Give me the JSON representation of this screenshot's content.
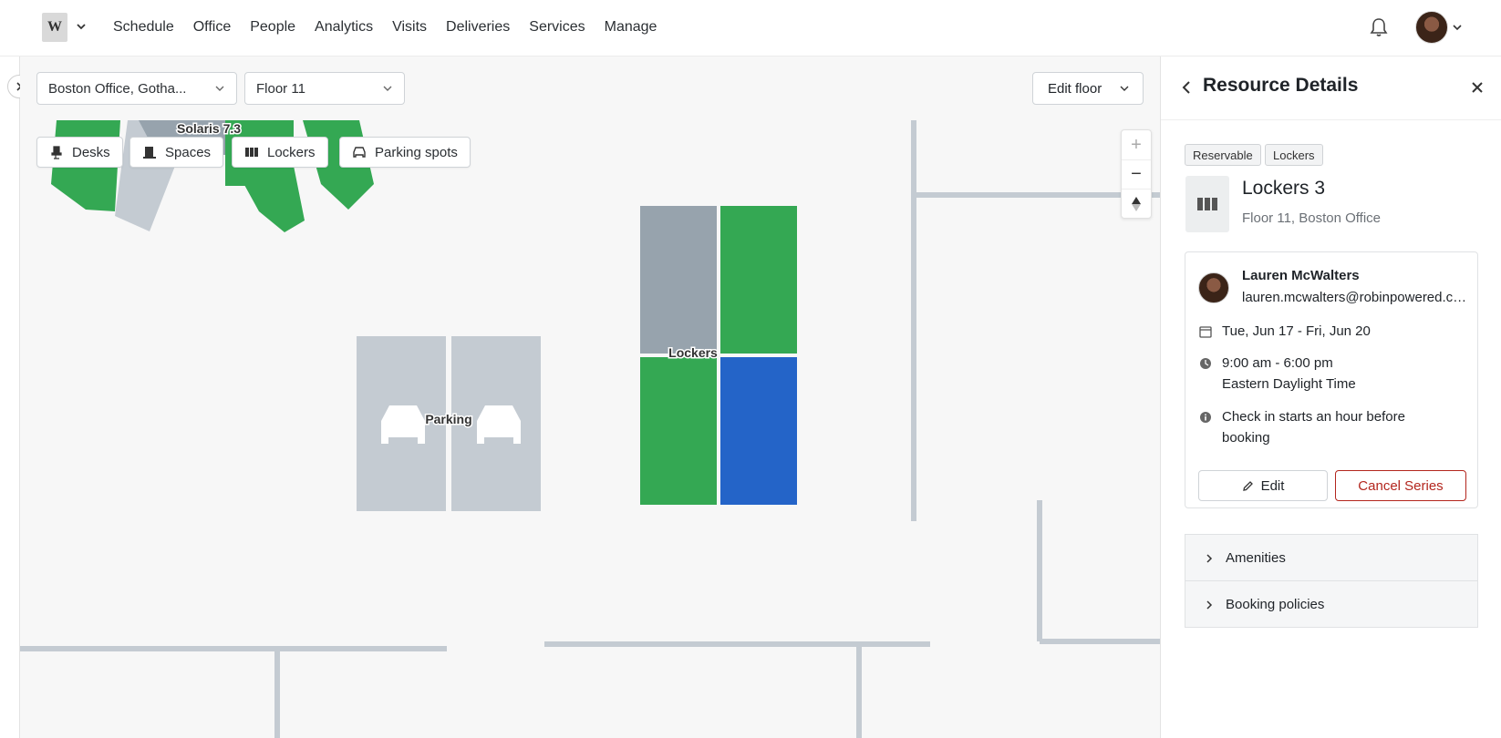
{
  "topnav": {
    "logo_text": "W",
    "items": [
      "Schedule",
      "Office",
      "People",
      "Analytics",
      "Visits",
      "Deliveries",
      "Services",
      "Manage"
    ]
  },
  "toolbar": {
    "building_select": "Boston Office, Gotha...",
    "floor_select": "Floor 11",
    "edit_floor": "Edit floor"
  },
  "filters": [
    "Desks",
    "Spaces",
    "Lockers",
    "Parking spots"
  ],
  "map": {
    "labels": {
      "solaris": "Solaris 7.3",
      "lockers": "Lockers",
      "parking": "Parking"
    },
    "colors": {
      "available": "#34a853",
      "unavailable": "#97a3ad",
      "selected": "#2464c8",
      "parking": "#c4cbd2",
      "wall": "#c4cbd2"
    }
  },
  "panel": {
    "title": "Resource Details",
    "tags": [
      "Reservable",
      "Lockers"
    ],
    "resource_name": "Lockers 3",
    "resource_location": "Floor 11, Boston Office",
    "booking": {
      "user_name": "Lauren McWalters",
      "user_email": "lauren.mcwalters@robinpowered.com",
      "dates": "Tue, Jun 17 - Fri, Jun 20",
      "time": "9:00 am - 6:00 pm",
      "timezone": "Eastern Daylight Time",
      "checkin_line1": "Check in starts an hour before",
      "checkin_line2": "booking",
      "edit_label": "Edit",
      "cancel_label": "Cancel Series"
    },
    "accordions": [
      "Amenities",
      "Booking policies"
    ]
  }
}
